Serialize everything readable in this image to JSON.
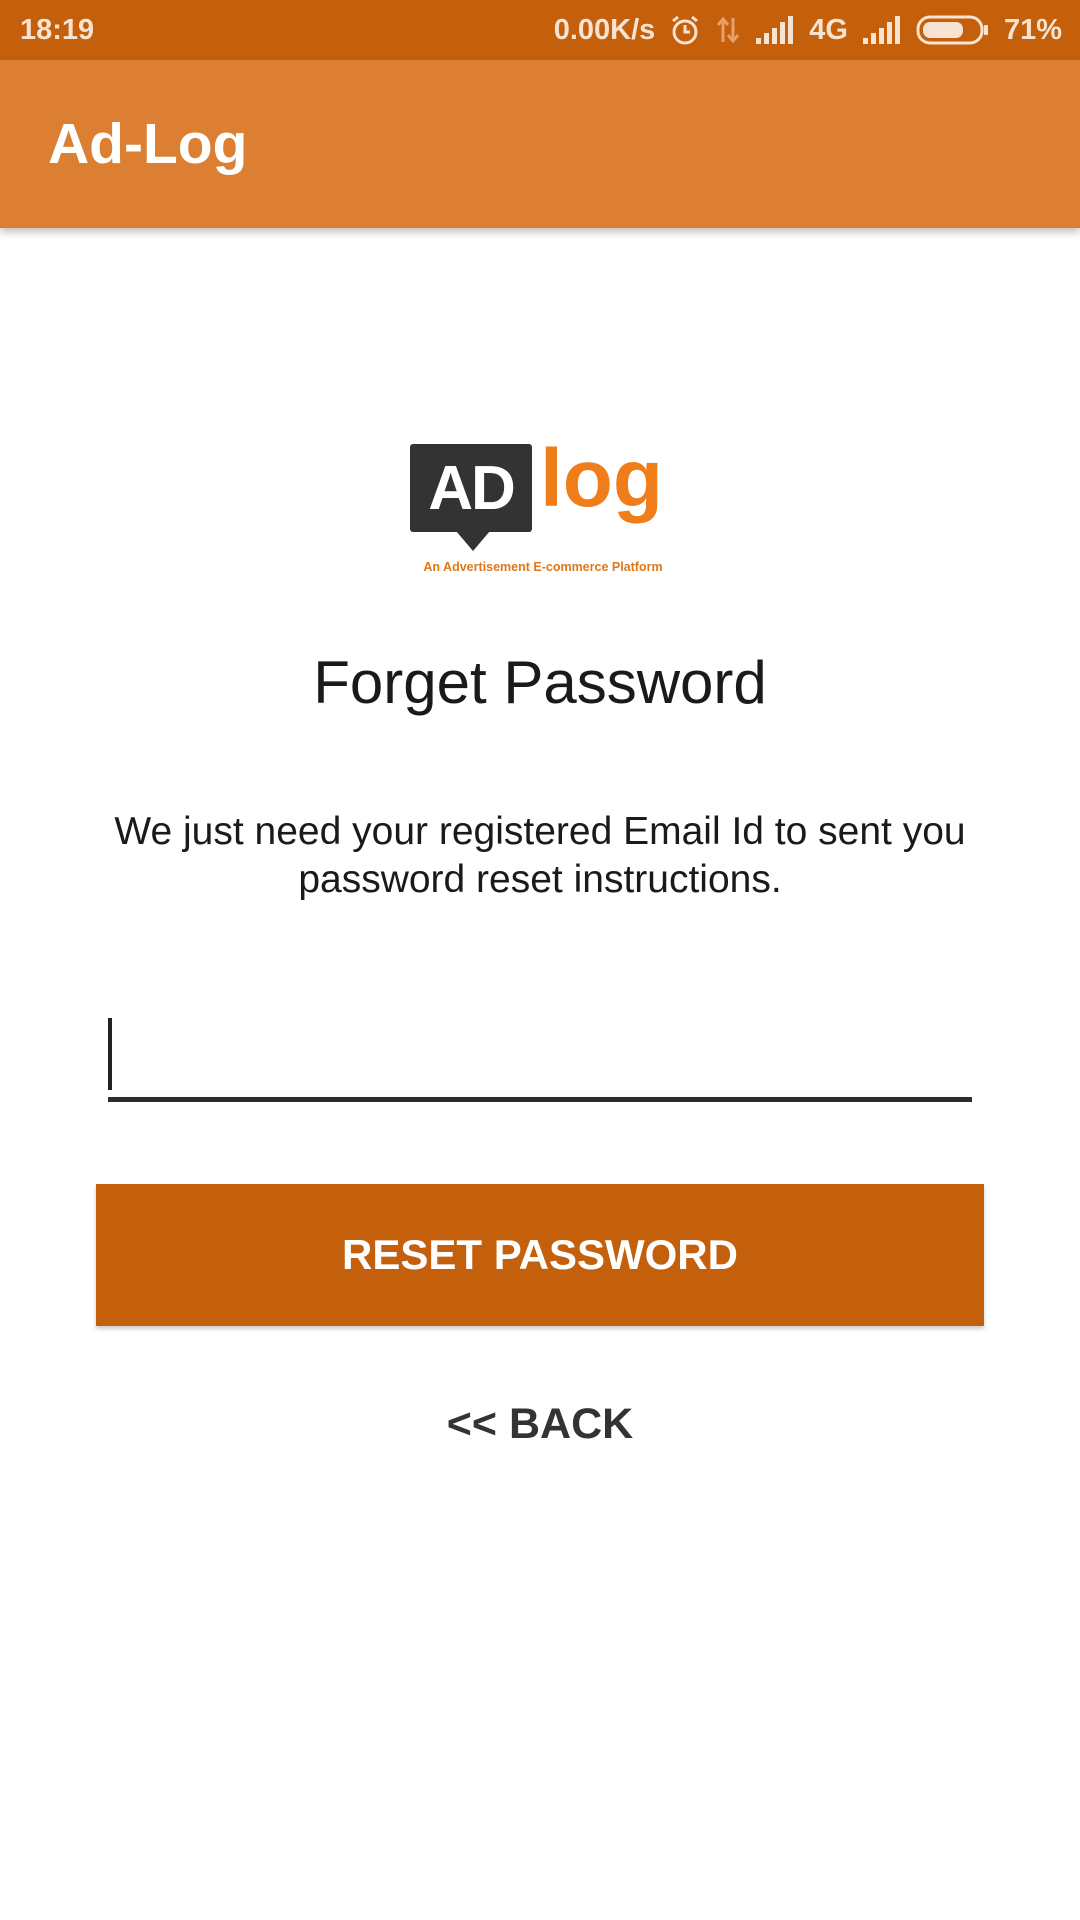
{
  "status_bar": {
    "time": "18:19",
    "network_speed": "0.00K/s",
    "network_type": "4G",
    "battery": "71%",
    "battery_level": 0.71,
    "icons": [
      "alarm-icon",
      "data-transfer-icon",
      "signal-icon",
      "signal-icon",
      "battery-icon"
    ]
  },
  "app_bar": {
    "title": "Ad-Log"
  },
  "logo": {
    "brand_box_text": "AD",
    "brand_text": "log",
    "tagline": "An Advertisement E-commerce Platform"
  },
  "form": {
    "heading": "Forget Password",
    "description": "We just need your registered Email Id to sent you password reset instructions.",
    "email_value": "",
    "reset_label": "RESET PASSWORD",
    "back_label": "<< BACK"
  },
  "colors": {
    "status_bar": "#c45f0b",
    "app_bar": "#dc7f32",
    "button": "#c45f0b",
    "brand_orange": "#ef7d1a",
    "brand_dark": "#333333"
  }
}
